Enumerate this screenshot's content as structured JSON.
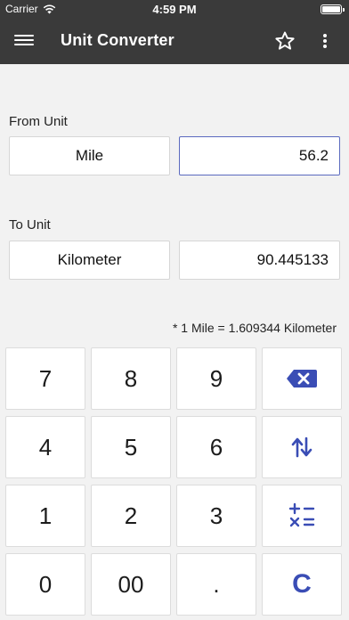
{
  "status": {
    "carrier": "Carrier",
    "time": "4:59 PM",
    "battery_level": 1.0
  },
  "appbar": {
    "title": "Unit Converter",
    "icons": [
      "menu-icon",
      "star-outline-icon",
      "more-vert-icon"
    ]
  },
  "from": {
    "label": "From Unit",
    "unit": "Mile",
    "value": "56.2"
  },
  "to": {
    "label": "To Unit",
    "unit": "Kilometer",
    "value": "90.445133"
  },
  "formula": "* 1 Mile = 1.609344 Kilometer",
  "keypad": {
    "rows": [
      [
        {
          "label": "7"
        },
        {
          "label": "8"
        },
        {
          "label": "9"
        },
        {
          "icon": "backspace-icon"
        }
      ],
      [
        {
          "label": "4"
        },
        {
          "label": "5"
        },
        {
          "label": "6"
        },
        {
          "icon": "swap-vertical-icon"
        }
      ],
      [
        {
          "label": "1"
        },
        {
          "label": "2"
        },
        {
          "label": "3"
        },
        {
          "icon": "calculator-icon"
        }
      ],
      [
        {
          "label": "0"
        },
        {
          "label": "00"
        },
        {
          "label": "."
        },
        {
          "label": "C"
        }
      ]
    ]
  },
  "colors": {
    "appbar": "#3a3a3a",
    "accent": "#3a4db5",
    "background": "#f2f2f2"
  }
}
